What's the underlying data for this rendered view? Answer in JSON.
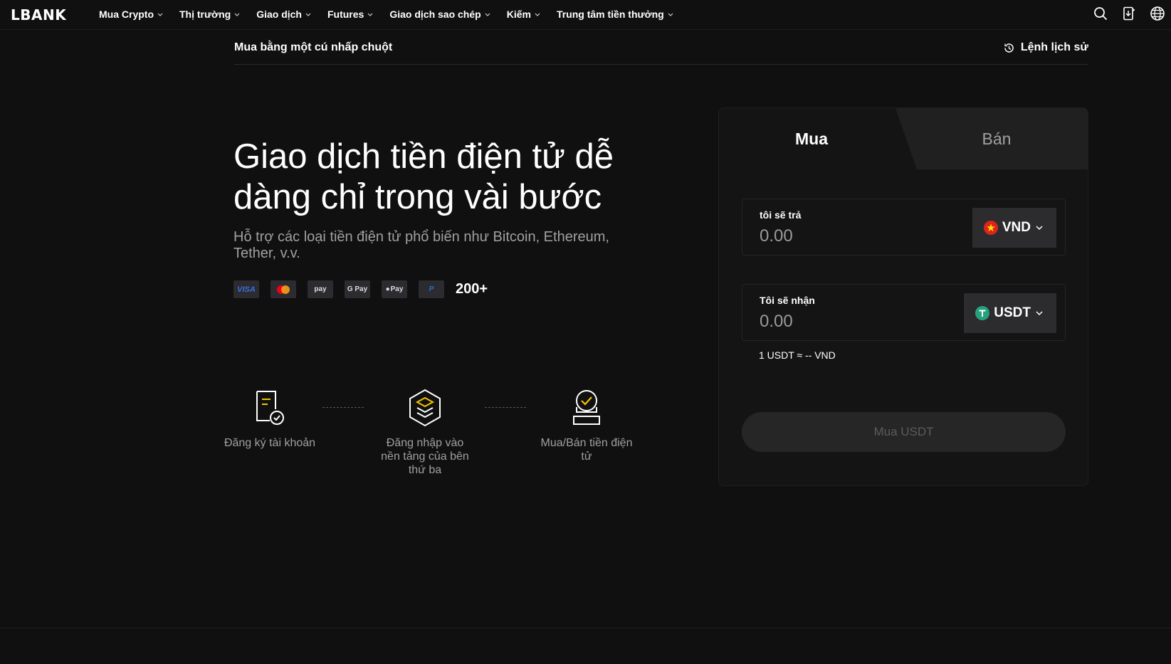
{
  "header": {
    "logo": "LBANK",
    "nav": [
      {
        "label": "Mua Crypto"
      },
      {
        "label": "Thị trường"
      },
      {
        "label": "Giao dịch"
      },
      {
        "label": "Futures"
      },
      {
        "label": "Giao dịch sao chép"
      },
      {
        "label": "Kiếm"
      },
      {
        "label": "Trung tâm tiền thưởng"
      }
    ],
    "icons": [
      "search-icon",
      "download-icon",
      "globe-icon"
    ]
  },
  "subheader": {
    "title": "Mua bằng một cú nhấp chuột",
    "history_label": "Lệnh lịch sử"
  },
  "hero": {
    "title": "Giao dịch tiền điện tử dễ dàng chỉ trong vài bước",
    "subtitle": "Hỗ trợ các loại tiền điện tử phổ biến như Bitcoin, Ethereum, Tether, v.v.",
    "payments": {
      "visa": "VISA",
      "samsung": "pay",
      "gpay": "G Pay",
      "applepay": "Pay",
      "paypal": "P",
      "count": "200+"
    }
  },
  "steps": [
    {
      "label": "Đăng ký tài khoản"
    },
    {
      "label": "Đăng nhập vào nền tảng của bên thứ ba"
    },
    {
      "label": "Mua/Bán tiền điện tử"
    }
  ],
  "form": {
    "tab_buy": "Mua",
    "tab_sell": "Bán",
    "pay_label": "tôi sẽ trả",
    "pay_placeholder": "0.00",
    "pay_currency": "VND",
    "receive_label": "Tôi sẽ nhận",
    "receive_placeholder": "0.00",
    "receive_currency": "USDT",
    "rate": "1 USDT ≈ -- VND",
    "submit": "Mua USDT"
  },
  "colors": {
    "background": "#101010",
    "accent": "#f5c400",
    "vnd_flag": "#da251d",
    "usdt": "#26a17b"
  }
}
